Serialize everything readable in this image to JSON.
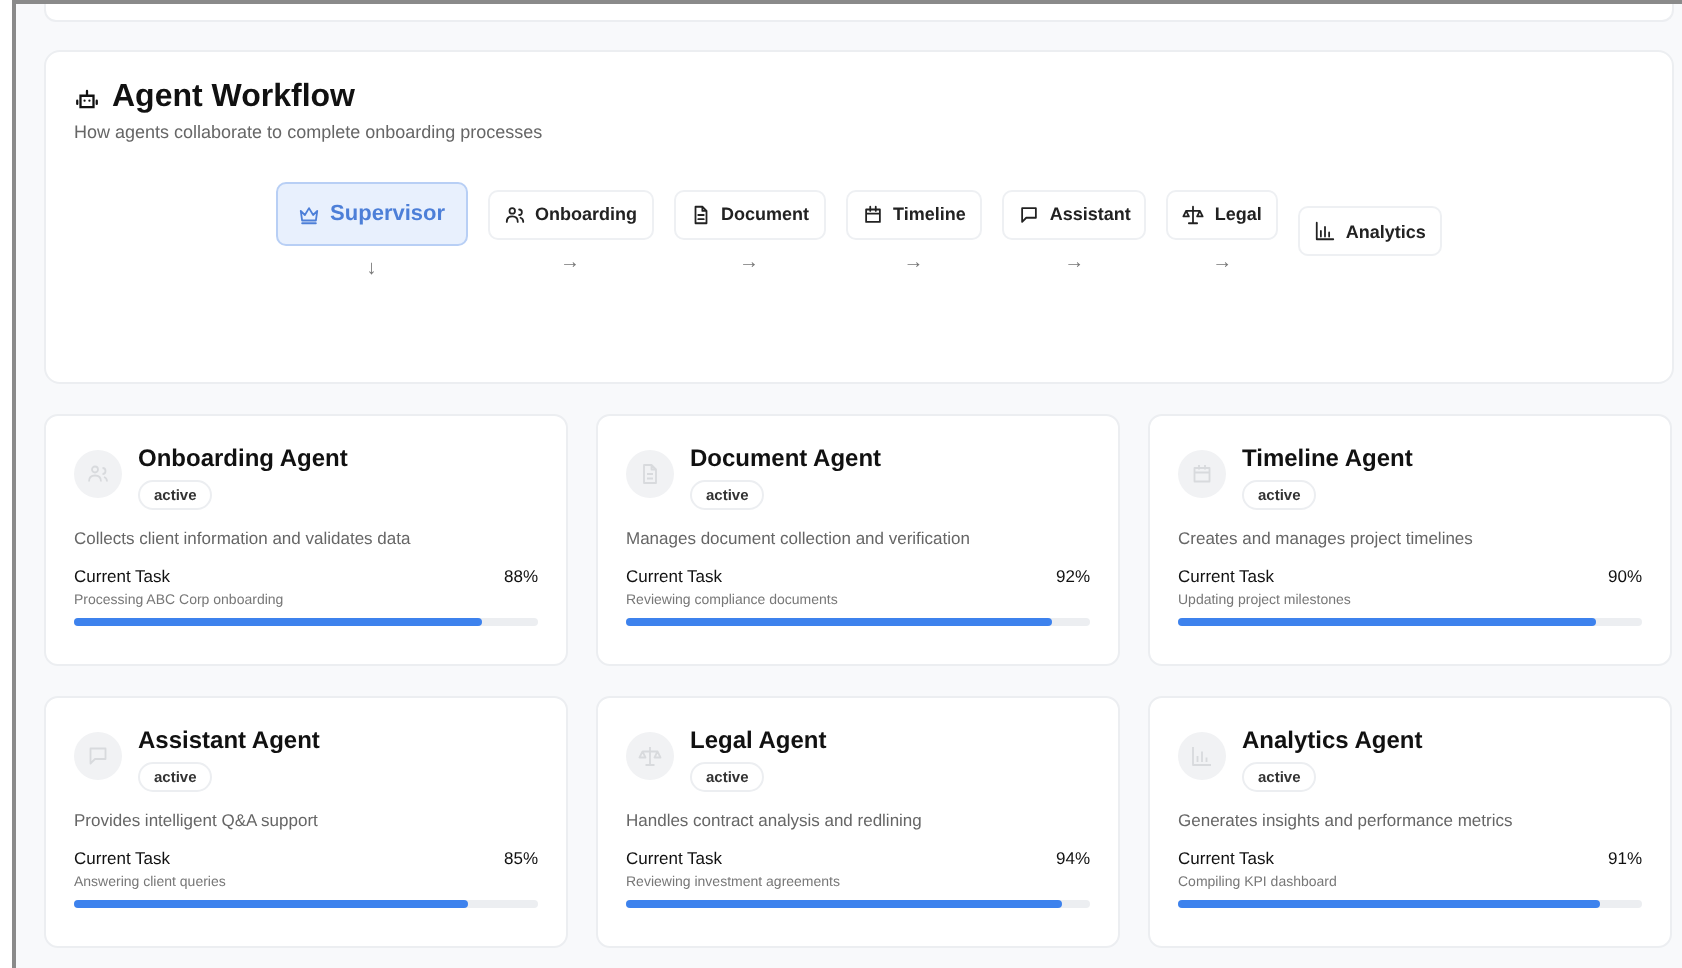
{
  "workflow": {
    "title": "Agent Workflow",
    "subtitle": "How agents collaborate to complete onboarding processes",
    "nodes": [
      {
        "label": "Supervisor",
        "selected": true,
        "arrow": "↓"
      },
      {
        "label": "Onboarding",
        "selected": false,
        "arrow": "→"
      },
      {
        "label": "Document",
        "selected": false,
        "arrow": "→"
      },
      {
        "label": "Timeline",
        "selected": false,
        "arrow": "→"
      },
      {
        "label": "Assistant",
        "selected": false,
        "arrow": "→"
      },
      {
        "label": "Legal",
        "selected": false,
        "arrow": "→"
      },
      {
        "label": "Analytics",
        "selected": false
      }
    ]
  },
  "agents": [
    {
      "name": "Onboarding Agent",
      "status": "active",
      "description": "Collects client information and validates data",
      "task_label": "Current Task",
      "percent": "88%",
      "task": "Processing ABC Corp onboarding",
      "level": 0.88
    },
    {
      "name": "Document Agent",
      "status": "active",
      "description": "Manages document collection and verification",
      "task_label": "Current Task",
      "percent": "92%",
      "task": "Reviewing compliance documents",
      "level": 0.92
    },
    {
      "name": "Timeline Agent",
      "status": "active",
      "description": "Creates and manages project timelines",
      "task_label": "Current Task",
      "percent": "90%",
      "task": "Updating project milestones",
      "level": 0.9
    },
    {
      "name": "Assistant Agent",
      "status": "active",
      "description": "Provides intelligent Q&A support",
      "task_label": "Current Task",
      "percent": "85%",
      "task": "Answering client queries",
      "level": 0.85
    },
    {
      "name": "Legal Agent",
      "status": "active",
      "description": "Handles contract analysis and redlining",
      "task_label": "Current Task",
      "percent": "94%",
      "task": "Reviewing investment agreements",
      "level": 0.94
    },
    {
      "name": "Analytics Agent",
      "status": "active",
      "description": "Generates insights and performance metrics",
      "task_label": "Current Task",
      "percent": "91%",
      "task": "Compiling KPI dashboard",
      "level": 0.91
    }
  ]
}
